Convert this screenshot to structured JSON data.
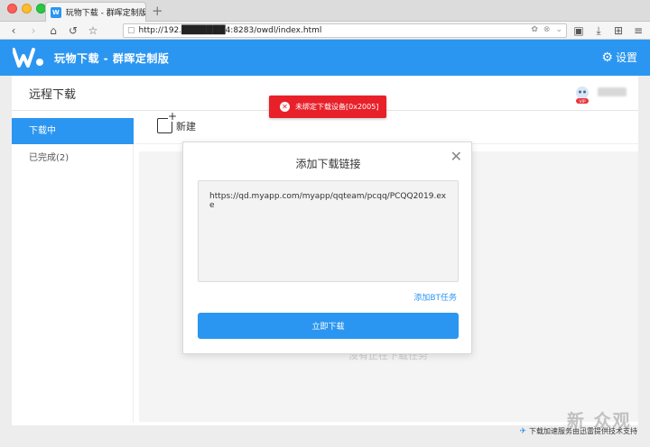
{
  "browser": {
    "tab_title": "玩物下载 - 群晖定制版",
    "favicon_glyph": "W",
    "new_tab": "+",
    "url": "http://192.███████4:8283/owdl/index.html"
  },
  "app": {
    "title": "玩物下载 - 群晖定制版",
    "settings_label": "设置",
    "accent": "#2b96f1"
  },
  "page": {
    "title": "远程下载",
    "avatar_badge": "VIP"
  },
  "sidebar": {
    "items": [
      {
        "label": "下载中"
      },
      {
        "label": "已完成(2)"
      }
    ]
  },
  "toolbar": {
    "new_label": "新建"
  },
  "empty_state": "没有正在下载任务",
  "toast": {
    "message": "未绑定下载设备[0x2005]",
    "color": "#e8202a"
  },
  "modal": {
    "title": "添加下载链接",
    "close_glyph": "✕",
    "link_value": "https://qd.myapp.com/myapp/qqteam/pcqq/PCQQ2019.exe",
    "bt_link": "添加BT任务",
    "submit_label": "立即下载"
  },
  "footer": {
    "text": "下载加速服务由迅雷提供技术支持"
  },
  "watermark": "新 众观"
}
